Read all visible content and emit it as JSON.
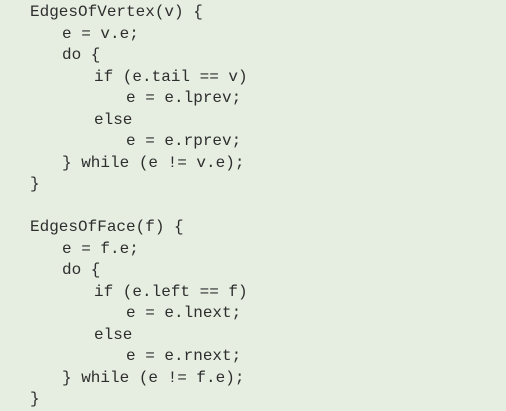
{
  "code": {
    "block1": {
      "line1": "EdgesOfVertex(v) {",
      "line2": "e = v.e;",
      "line3": "do {",
      "line4": "if (e.tail == v)",
      "line5": "e = e.lprev;",
      "line6": "else",
      "line7": "e = e.rprev;",
      "line8": "} while (e != v.e);",
      "line9": "}"
    },
    "block2": {
      "line1": "EdgesOfFace(f) {",
      "line2": "e = f.e;",
      "line3": "do {",
      "line4": "if (e.left == f)",
      "line5": "e = e.lnext;",
      "line6": "else",
      "line7": "e = e.rnext;",
      "line8": "} while (e != f.e);",
      "line9": "}"
    }
  }
}
